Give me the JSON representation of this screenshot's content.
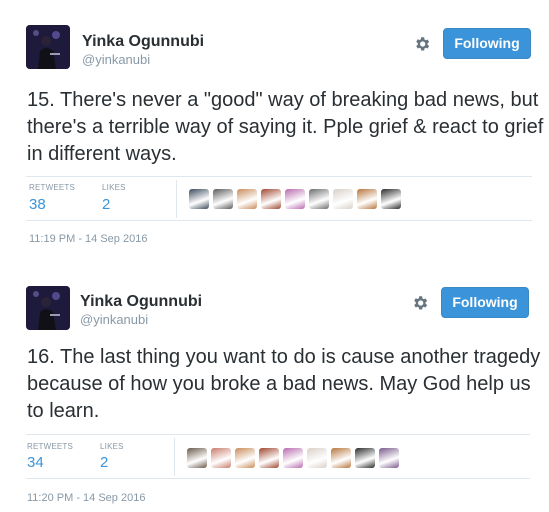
{
  "tweets": [
    {
      "user": {
        "name": "Yinka Ogunnubi",
        "handle": "@yinkanubi"
      },
      "follow_label": "Following",
      "text": "15. There's never a \"good\" way of breaking bad news, but there's a terrible way of saying it. Pple grief & react to grief in different ways.",
      "stats": {
        "retweets_label": "RETWEETS",
        "retweets": "38",
        "likes_label": "LIKES",
        "likes": "2"
      },
      "likers": [
        "#3b4a5c",
        "#5a5a5a",
        "#c98b5a",
        "#a0462f",
        "#b86bb0",
        "#6d6d6d",
        "#d9d0c8",
        "#b8753b",
        "#2a2a2a"
      ],
      "timestamp": "11:19 PM - 14 Sep 2016"
    },
    {
      "user": {
        "name": "Yinka Ogunnubi",
        "handle": "@yinkanubi"
      },
      "follow_label": "Following",
      "text": "16. The last thing you want to do is cause another tragedy because of how you broke a bad news. May God help us to learn.",
      "stats": {
        "retweets_label": "RETWEETS",
        "retweets": "34",
        "likes_label": "LIKES",
        "likes": "2"
      },
      "likers": [
        "#6a5a4a",
        "#c97b6b",
        "#c98b5a",
        "#a0462f",
        "#b86bb0",
        "#d9d0c8",
        "#b8753b",
        "#2a2a2a",
        "#7a5a8a"
      ],
      "timestamp": "11:20 PM - 14 Sep 2016"
    }
  ],
  "icons": {
    "gear": "gear-icon",
    "avatar": "profile-photo"
  },
  "colors": {
    "accent": "#3b94d9",
    "text": "#292f33",
    "muted": "#8899a6",
    "divider": "#e1e8ed"
  }
}
